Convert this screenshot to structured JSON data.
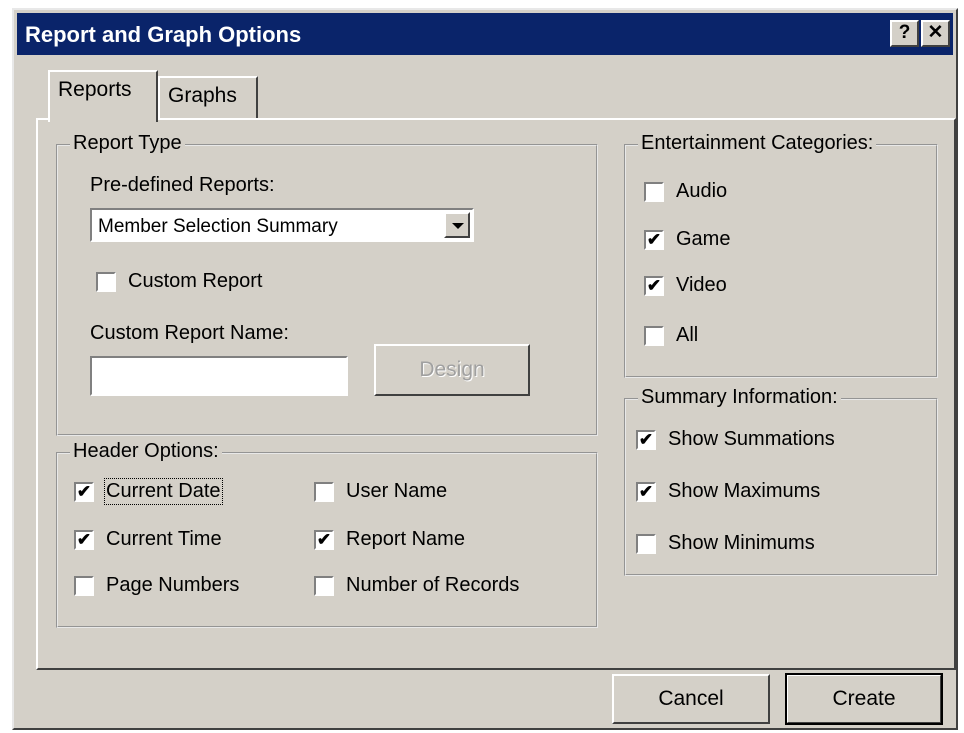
{
  "window": {
    "title": "Report and Graph Options",
    "help_glyph": "?",
    "close_glyph": "✕"
  },
  "tabs": [
    {
      "label": "Reports",
      "selected": true
    },
    {
      "label": "Graphs",
      "selected": false
    }
  ],
  "report_type": {
    "legend": "Report Type",
    "predefined_label": "Pre-defined Reports:",
    "predefined_value": "Member Selection Summary",
    "custom_report": {
      "label": "Custom Report",
      "checked": false
    },
    "custom_name_label": "Custom Report Name:",
    "custom_name_value": "",
    "design_label": "Design"
  },
  "header_options": {
    "legend": "Header Options:",
    "items": [
      {
        "label": "Current Date",
        "checked": true
      },
      {
        "label": "User Name",
        "checked": false
      },
      {
        "label": "Current Time",
        "checked": true
      },
      {
        "label": "Report Name",
        "checked": true
      },
      {
        "label": "Page Numbers",
        "checked": false
      },
      {
        "label": "Number of Records",
        "checked": false
      }
    ]
  },
  "entertainment": {
    "legend": "Entertainment Categories:",
    "items": [
      {
        "label": "Audio",
        "checked": false
      },
      {
        "label": "Game",
        "checked": true
      },
      {
        "label": "Video",
        "checked": true
      },
      {
        "label": "All",
        "checked": false
      }
    ]
  },
  "summary": {
    "legend": "Summary Information:",
    "items": [
      {
        "label": "Show Summations",
        "checked": true
      },
      {
        "label": "Show Maximums",
        "checked": true
      },
      {
        "label": "Show Minimums",
        "checked": false
      }
    ]
  },
  "buttons": {
    "cancel": "Cancel",
    "create": "Create"
  },
  "check_mark": "✔",
  "colors": {
    "titlebar": "#0a246a",
    "face": "#d4d0c8"
  }
}
